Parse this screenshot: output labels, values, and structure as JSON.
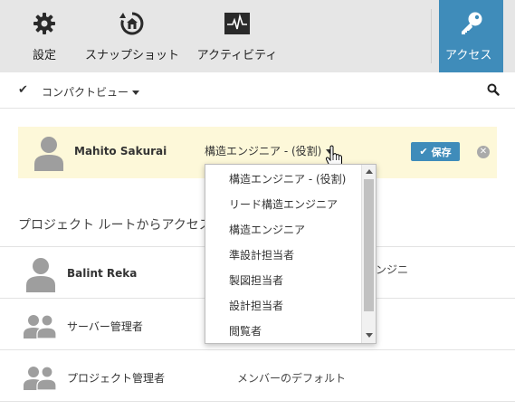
{
  "colors": {
    "accent": "#3f8cba",
    "toolbar_bg": "#e6e6e6",
    "highlight_bg": "#fdf8d9",
    "avatar": "#9e9e9e"
  },
  "toolbar": {
    "settings": {
      "label": "設定",
      "icon": "gear-icon"
    },
    "snapshot": {
      "label": "スナップショット",
      "icon": "snapshot-icon"
    },
    "activity": {
      "label": "アクティビティ",
      "icon": "activity-icon"
    },
    "access": {
      "label": "アクセス",
      "icon": "key-icon"
    }
  },
  "view": {
    "check": "✔",
    "label": "コンパクトビュー",
    "search_icon": "search-icon"
  },
  "editing_member": {
    "name": "Mahito Sakurai",
    "role": "構造エンジニア - (役割)",
    "save_label": "保存",
    "close_icon": "close-icon"
  },
  "role_options": [
    "構造エンジニア - (役割)",
    "リード構造エンジニア",
    "構造エンジニア",
    "準設計担当者",
    "製図担当者",
    "設計担当者",
    "閲覧者"
  ],
  "section": {
    "title": "プロジェクト ルートからアクセス"
  },
  "members": [
    {
      "name": "Balint Reka",
      "role_partial": "ンジニ"
    },
    {
      "name": "サーバー管理者",
      "role": ""
    },
    {
      "name": "プロジェクト管理者",
      "role": "メンバーのデフォルト"
    }
  ]
}
